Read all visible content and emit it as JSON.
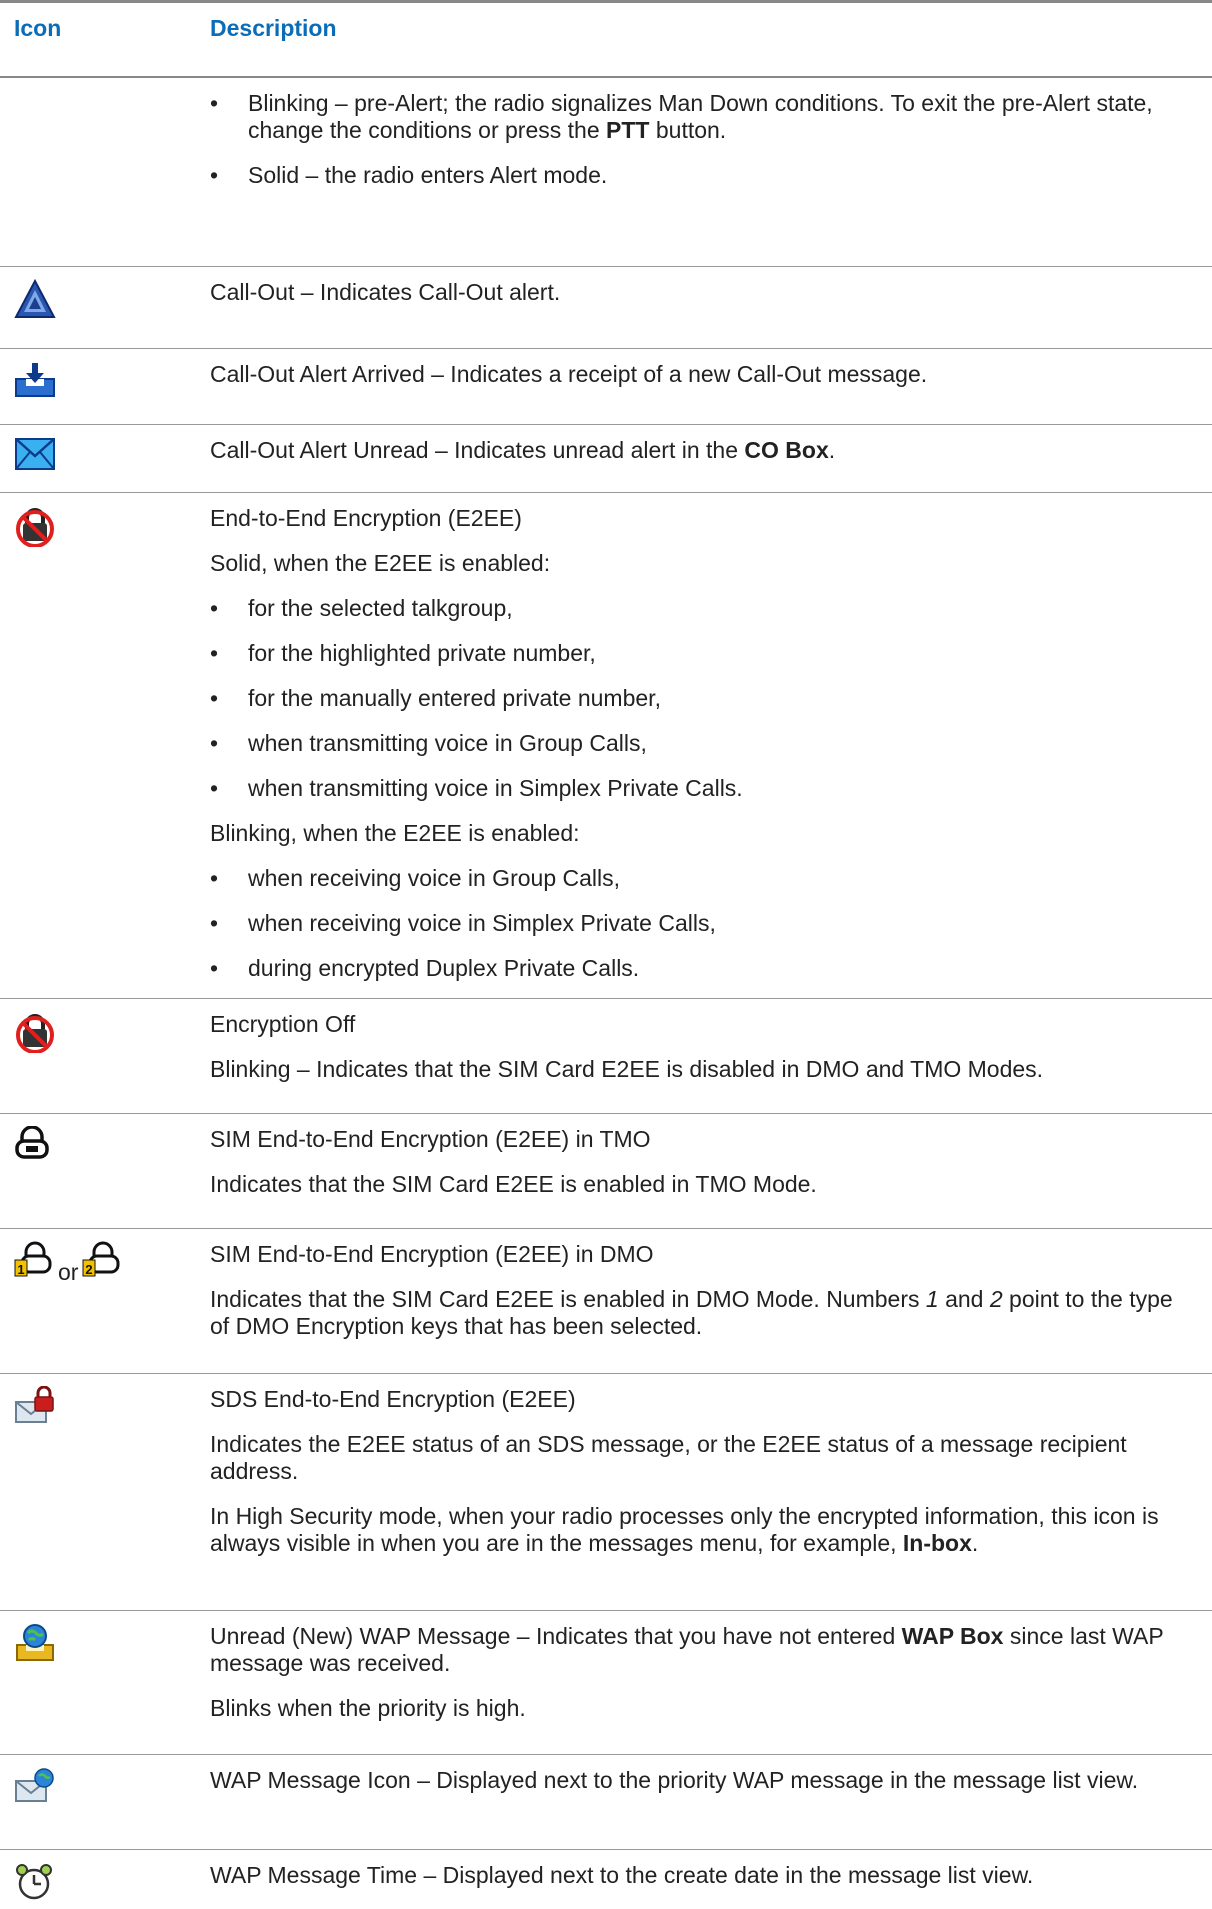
{
  "header": {
    "icon": "Icon",
    "description": "Description"
  },
  "row0": {
    "b1": "Blinking – pre-Alert; the radio signalizes Man Down conditions. To exit the pre-Alert state, change the conditions or press the ",
    "b1_bold": "PTT",
    "b1_tail": " button.",
    "b2": "Solid – the radio enters Alert mode."
  },
  "row1": {
    "icon": "call-out-triangle-icon",
    "text": "Call-Out – Indicates Call-Out alert."
  },
  "row2": {
    "icon": "inbox-download-icon",
    "text": "Call-Out Alert Arrived – Indicates a receipt of a new Call-Out message."
  },
  "row3": {
    "icon": "envelope-icon",
    "text": "Call-Out Alert Unread – Indicates unread alert in the ",
    "bold": "CO Box",
    "tail": "."
  },
  "row4": {
    "icon": "e2ee-crossed-lock-icon",
    "title": "End-to-End Encryption (E2EE)",
    "solid": "Solid, when the E2EE is enabled:",
    "solid_items": [
      "for the selected talkgroup,",
      "for the highlighted private number,",
      "for the manually entered private number,",
      "when transmitting voice in Group Calls,",
      "when transmitting voice in Simplex Private Calls."
    ],
    "blinking": "Blinking, when the E2EE is enabled:",
    "blinking_items": [
      "when receiving voice in Group Calls,",
      "when receiving voice in Simplex Private Calls,",
      "during encrypted Duplex Private Calls."
    ]
  },
  "row5": {
    "icon": "encryption-off-icon",
    "title": "Encryption Off",
    "text": "Blinking – Indicates that the SIM Card E2EE is disabled in DMO and TMO Modes."
  },
  "row6": {
    "icon": "sim-lock-icon",
    "title": "SIM End-to-End Encryption (E2EE) in TMO",
    "text": "Indicates that the SIM Card E2EE is enabled in TMO Mode."
  },
  "row7": {
    "icon1": "sim-lock-key1-icon",
    "or": "or",
    "icon2": "sim-lock-key2-icon",
    "title": "SIM End-to-End Encryption (E2EE) in DMO",
    "text_a": "Indicates that the SIM Card E2EE is enabled in DMO Mode. Numbers ",
    "num1": "1",
    "text_b": " and ",
    "num2": "2",
    "text_c": " point to the type of DMO Encryption keys that has been selected."
  },
  "row8": {
    "icon": "sds-envelope-lock-icon",
    "title": "SDS End-to-End Encryption (E2EE)",
    "text1": "Indicates the E2EE status of an SDS message, or the E2EE status of a message recipient address.",
    "text2": "In High Security mode, when your radio processes only the encrypted information, this icon is always visible in when you are in the messages menu, for example, ",
    "text2_bold": "In-box",
    "text2_tail": "."
  },
  "row9": {
    "icon": "wap-unread-icon",
    "text_a": "Unread (New) WAP Message – Indicates that you have not entered ",
    "bold": "WAP Box",
    "text_b": " since last WAP message was received.",
    "text2": "Blinks when the priority is high."
  },
  "row10": {
    "icon": "wap-message-icon",
    "text": "WAP Message Icon – Displayed next to the priority WAP message in the message list view."
  },
  "row11": {
    "icon": "alarm-clock-icon",
    "text": "WAP Message Time – Displayed next to the create date in the message list view."
  }
}
